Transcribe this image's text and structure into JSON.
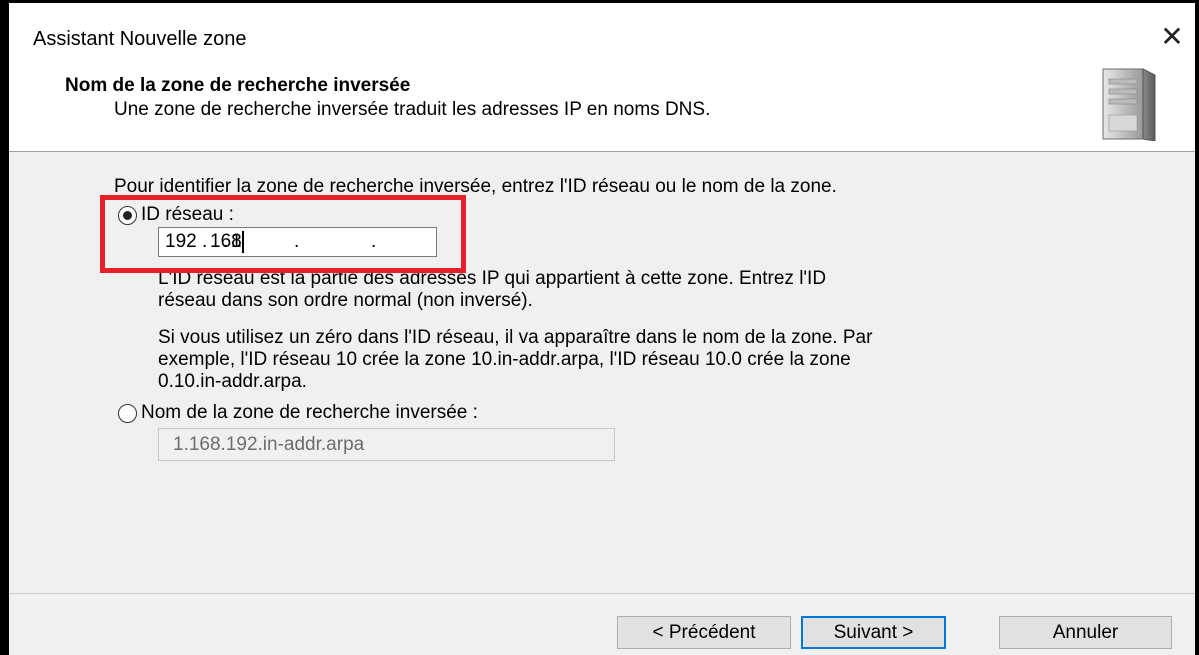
{
  "window": {
    "title": "Assistant Nouvelle zone",
    "close_glyph": "✕"
  },
  "header": {
    "title": "Nom de la zone de recherche inversée",
    "subtitle": "Une zone de recherche inversée traduit les adresses IP en noms DNS.",
    "icon": "server-icon"
  },
  "body": {
    "instruction": "Pour identifier la zone de recherche inversée, entrez l'ID réseau ou le nom de la zone.",
    "option_network_id": {
      "label": "ID réseau :",
      "selected": true
    },
    "network_id": {
      "octets": [
        "192",
        "168",
        "1",
        ""
      ],
      "separator": "."
    },
    "desc1_line1": "L'ID réseau est la partie des adresses IP qui appartient à cette zone. Entrez l'ID",
    "desc1_line2": "réseau dans son ordre normal (non inversé).",
    "desc2_line1": "Si vous utilisez un zéro dans l'ID réseau, il va apparaître dans le nom de la zone. Par",
    "desc2_line2": "exemple, l'ID réseau 10 crée la zone 10.in-addr.arpa, l'ID réseau 10.0 crée la zone",
    "desc2_line3": "0.10.in-addr.arpa.",
    "option_zone_name": {
      "label": "Nom de la zone de recherche inversée :",
      "selected": false
    },
    "zone_name_value": "1.168.192.in-addr.arpa"
  },
  "buttons": {
    "back": "< Précédent",
    "next": "Suivant >",
    "cancel": "Annuler"
  },
  "colors": {
    "highlight": "#e8202a",
    "focus": "#0078d7"
  }
}
